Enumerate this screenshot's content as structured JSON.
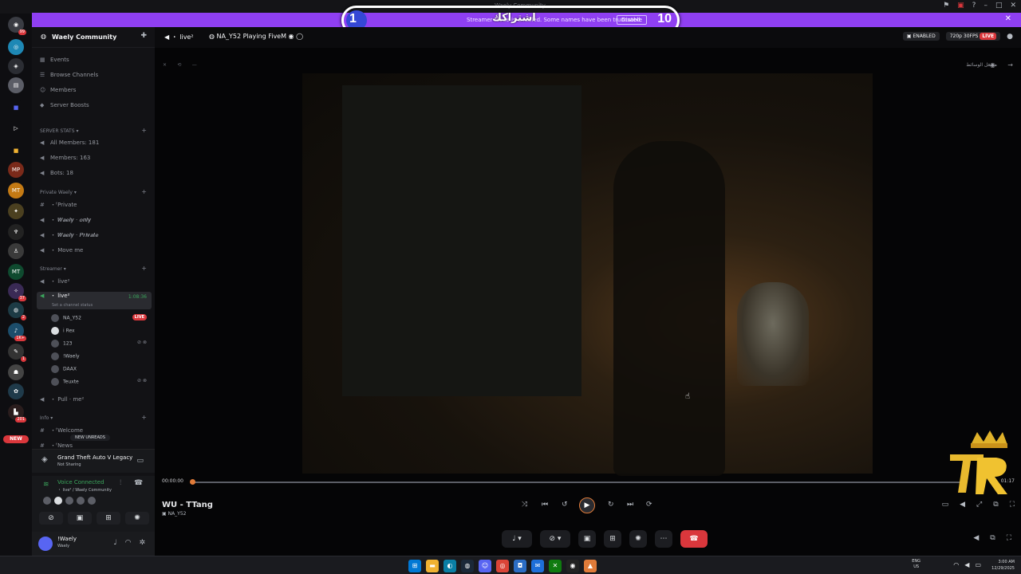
{
  "window": {
    "title": "Waely Community"
  },
  "banner": {
    "text": "Streamer Mode is enabled. Some names have been truncated.",
    "button": "Disable"
  },
  "overlay": {
    "start": "1",
    "mid": "اشتراكك",
    "end": "10"
  },
  "guilds": {
    "badges": [
      "99",
      "37",
      "2",
      "1K+",
      "1",
      "201"
    ],
    "new_label": "NEW"
  },
  "server": {
    "name": "Waely Community"
  },
  "sidebar": {
    "top_items": [
      "Events",
      "Browse Channels",
      "Members",
      "Server Boosts"
    ],
    "stats_category": "SERVER STATS",
    "stats": [
      "All Members: 181",
      "Members: 163",
      "Bots: 18"
    ],
    "private_category": "Private Waely",
    "private": [
      "・ᶠPrivate",
      "・ 𝑾𝒂𝒆𝒍𝒚 · 𝒐𝒏𝒍𝒚",
      "・ 𝑾𝒂𝒆𝒍𝒚 · 𝑷𝒓𝒊𝒗𝒂𝒕𝒆",
      "・ Move me"
    ],
    "streamer_category": "Streamer",
    "streamer_live": "・ live²",
    "active_channel": "・ live²",
    "active_status": "Set a channel status",
    "active_timer": "1:08:36",
    "voice_users": [
      "NA_Y52",
      "i Rex",
      "123",
      "!Waely",
      "DAAX",
      "Teuxte"
    ],
    "live_label": "LIVE",
    "pull": "・ Pull · me²",
    "info_category": "Info",
    "info": [
      "・ᶠWelcome",
      "・ᶠNews"
    ],
    "new_unreads": "NEW UNREADS"
  },
  "activity": {
    "title": "Grand Theft Auto V Legacy",
    "subtitle": "Not Sharing"
  },
  "voice": {
    "title": "Voice Connected",
    "subtitle": "・ live² / Waely Community"
  },
  "user": {
    "name": "!Waely",
    "status": "Waely"
  },
  "header": {
    "channel": "・ live²",
    "stream": "NA_Y52 Playing FiveM",
    "enabled": "ENABLED",
    "quality": "720p 30FPS",
    "live": "LIVE"
  },
  "stage": {
    "media_label": "مشغل الوسائط"
  },
  "player": {
    "time": "00:00:00",
    "duration": "01:17",
    "progress": 0.0,
    "title": "WU - TTang",
    "subtitle": "NA_Y52"
  },
  "taskbar": {
    "lang_top": "ENG",
    "lang_bottom": "US",
    "time": "3:00 AM",
    "date": "12/29/2025"
  },
  "colors": {
    "accent": "#8f3ff2",
    "live": "#da373c",
    "voice": "#3ba55c",
    "progress": "#e07b39"
  }
}
